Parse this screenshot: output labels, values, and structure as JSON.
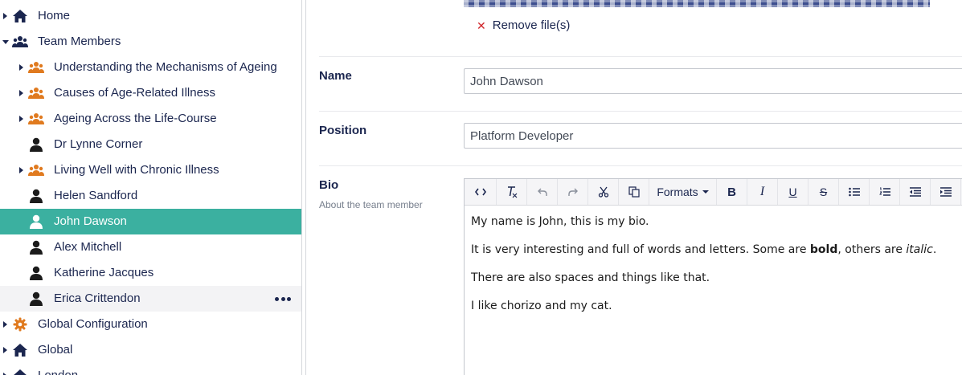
{
  "tree": {
    "items": [
      {
        "label": "Home",
        "icon": "home-icon",
        "caret": "right",
        "level": 0,
        "state": "normal",
        "name": "tree-item-home",
        "iconColor": "#1b264f"
      },
      {
        "label": "Team Members",
        "icon": "team-icon",
        "caret": "down",
        "level": 0,
        "state": "normal",
        "name": "tree-item-team-members",
        "iconColor": "#1b264f"
      },
      {
        "label": "Understanding the Mechanisms of Ageing",
        "icon": "team-icon",
        "caret": "right",
        "level": 1,
        "state": "normal",
        "name": "tree-item-understanding-mechanisms",
        "iconColor": "#e07a1f"
      },
      {
        "label": "Causes of Age-Related Illness",
        "icon": "team-icon",
        "caret": "right",
        "level": 1,
        "state": "normal",
        "name": "tree-item-causes-illness",
        "iconColor": "#e07a1f"
      },
      {
        "label": "Ageing Across the Life-Course",
        "icon": "team-icon",
        "caret": "right",
        "level": 1,
        "state": "normal",
        "name": "tree-item-ageing-life-course",
        "iconColor": "#e07a1f"
      },
      {
        "label": "Dr Lynne Corner",
        "icon": "person-icon",
        "caret": "",
        "level": 1,
        "state": "normal",
        "name": "tree-item-lynne-corner",
        "iconColor": "#1b1b1b"
      },
      {
        "label": "Living Well with Chronic Illness",
        "icon": "team-icon",
        "caret": "right",
        "level": 1,
        "state": "normal",
        "name": "tree-item-living-well",
        "iconColor": "#e07a1f"
      },
      {
        "label": "Helen Sandford",
        "icon": "person-icon",
        "caret": "",
        "level": 1,
        "state": "normal",
        "name": "tree-item-helen-sandford",
        "iconColor": "#1b1b1b"
      },
      {
        "label": "John Dawson",
        "icon": "person-icon",
        "caret": "",
        "level": 1,
        "state": "active",
        "name": "tree-item-john-dawson",
        "iconColor": "#ffffff"
      },
      {
        "label": "Alex Mitchell",
        "icon": "person-icon",
        "caret": "",
        "level": 1,
        "state": "normal",
        "name": "tree-item-alex-mitchell",
        "iconColor": "#1b1b1b"
      },
      {
        "label": "Katherine Jacques",
        "icon": "person-icon",
        "caret": "",
        "level": 1,
        "state": "normal",
        "name": "tree-item-katherine-jacques",
        "iconColor": "#1b1b1b"
      },
      {
        "label": "Erica Crittendon",
        "icon": "person-icon",
        "caret": "",
        "level": 1,
        "state": "hover",
        "name": "tree-item-erica-crittendon",
        "iconColor": "#1b1b1b",
        "actions": true
      },
      {
        "label": "Global Configuration",
        "icon": "gear-icon",
        "caret": "right",
        "level": 0,
        "state": "normal",
        "name": "tree-item-global-configuration",
        "iconColor": "#e07a1f"
      },
      {
        "label": "Global",
        "icon": "home-icon",
        "caret": "right",
        "level": 0,
        "state": "normal",
        "name": "tree-item-global",
        "iconColor": "#1b264f"
      },
      {
        "label": "London",
        "icon": "home-icon",
        "caret": "right",
        "level": 0,
        "state": "normal",
        "name": "tree-item-london",
        "iconColor": "#1b264f"
      }
    ]
  },
  "editor": {
    "remove_files_label": "Remove file(s)",
    "name": {
      "label": "Name",
      "value": "John Dawson"
    },
    "position": {
      "label": "Position",
      "value": "Platform Developer"
    },
    "bio": {
      "label": "Bio",
      "help": "About the team member",
      "toolbar": {
        "formats_label": "Formats",
        "buttons": [
          "code-icon",
          "clear-format-icon",
          "undo-icon",
          "redo-icon",
          "cut-icon",
          "copy-icon",
          "bold-icon",
          "italic-icon",
          "underline-icon",
          "strikethrough-icon",
          "bullet-list-icon",
          "numbered-list-icon",
          "outdent-icon",
          "indent-icon"
        ]
      },
      "content": {
        "p1": "My name is John, this is my bio.",
        "p2_pre": "It is very interesting and full of words and letters. Some are ",
        "p2_bold": "bold",
        "p2_mid": ", others are ",
        "p2_italic": "italic",
        "p2_post": ".",
        "p3": "There are also spaces and things like that.",
        "p4": "I like chorizo and my cat."
      }
    }
  },
  "colors": {
    "accent": "#3bb0a0",
    "text": "#1b264f",
    "remove": "#d0262b",
    "orange_icon": "#e07a1f"
  }
}
